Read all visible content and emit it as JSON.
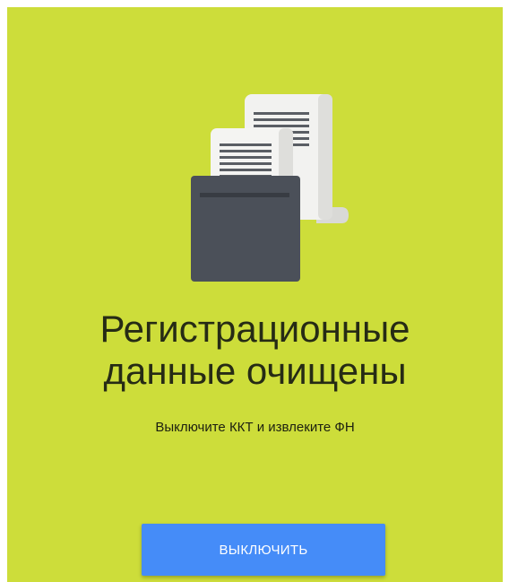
{
  "colors": {
    "background": "#cddd3a",
    "button": "#458cf8",
    "printer_body": "#4b5059",
    "paper": "#f2f2f0",
    "paper_shadow": "#d9d9d6",
    "paper_lines": "#5a5e64"
  },
  "icons": {
    "illustration": "printer-with-receipts-icon"
  },
  "main": {
    "title_line1": "Регистрационные",
    "title_line2": "данные очищены",
    "subtitle": "Выключите ККТ и извлеките ФН",
    "power_off_button": "ВЫКЛЮЧИТЬ"
  }
}
